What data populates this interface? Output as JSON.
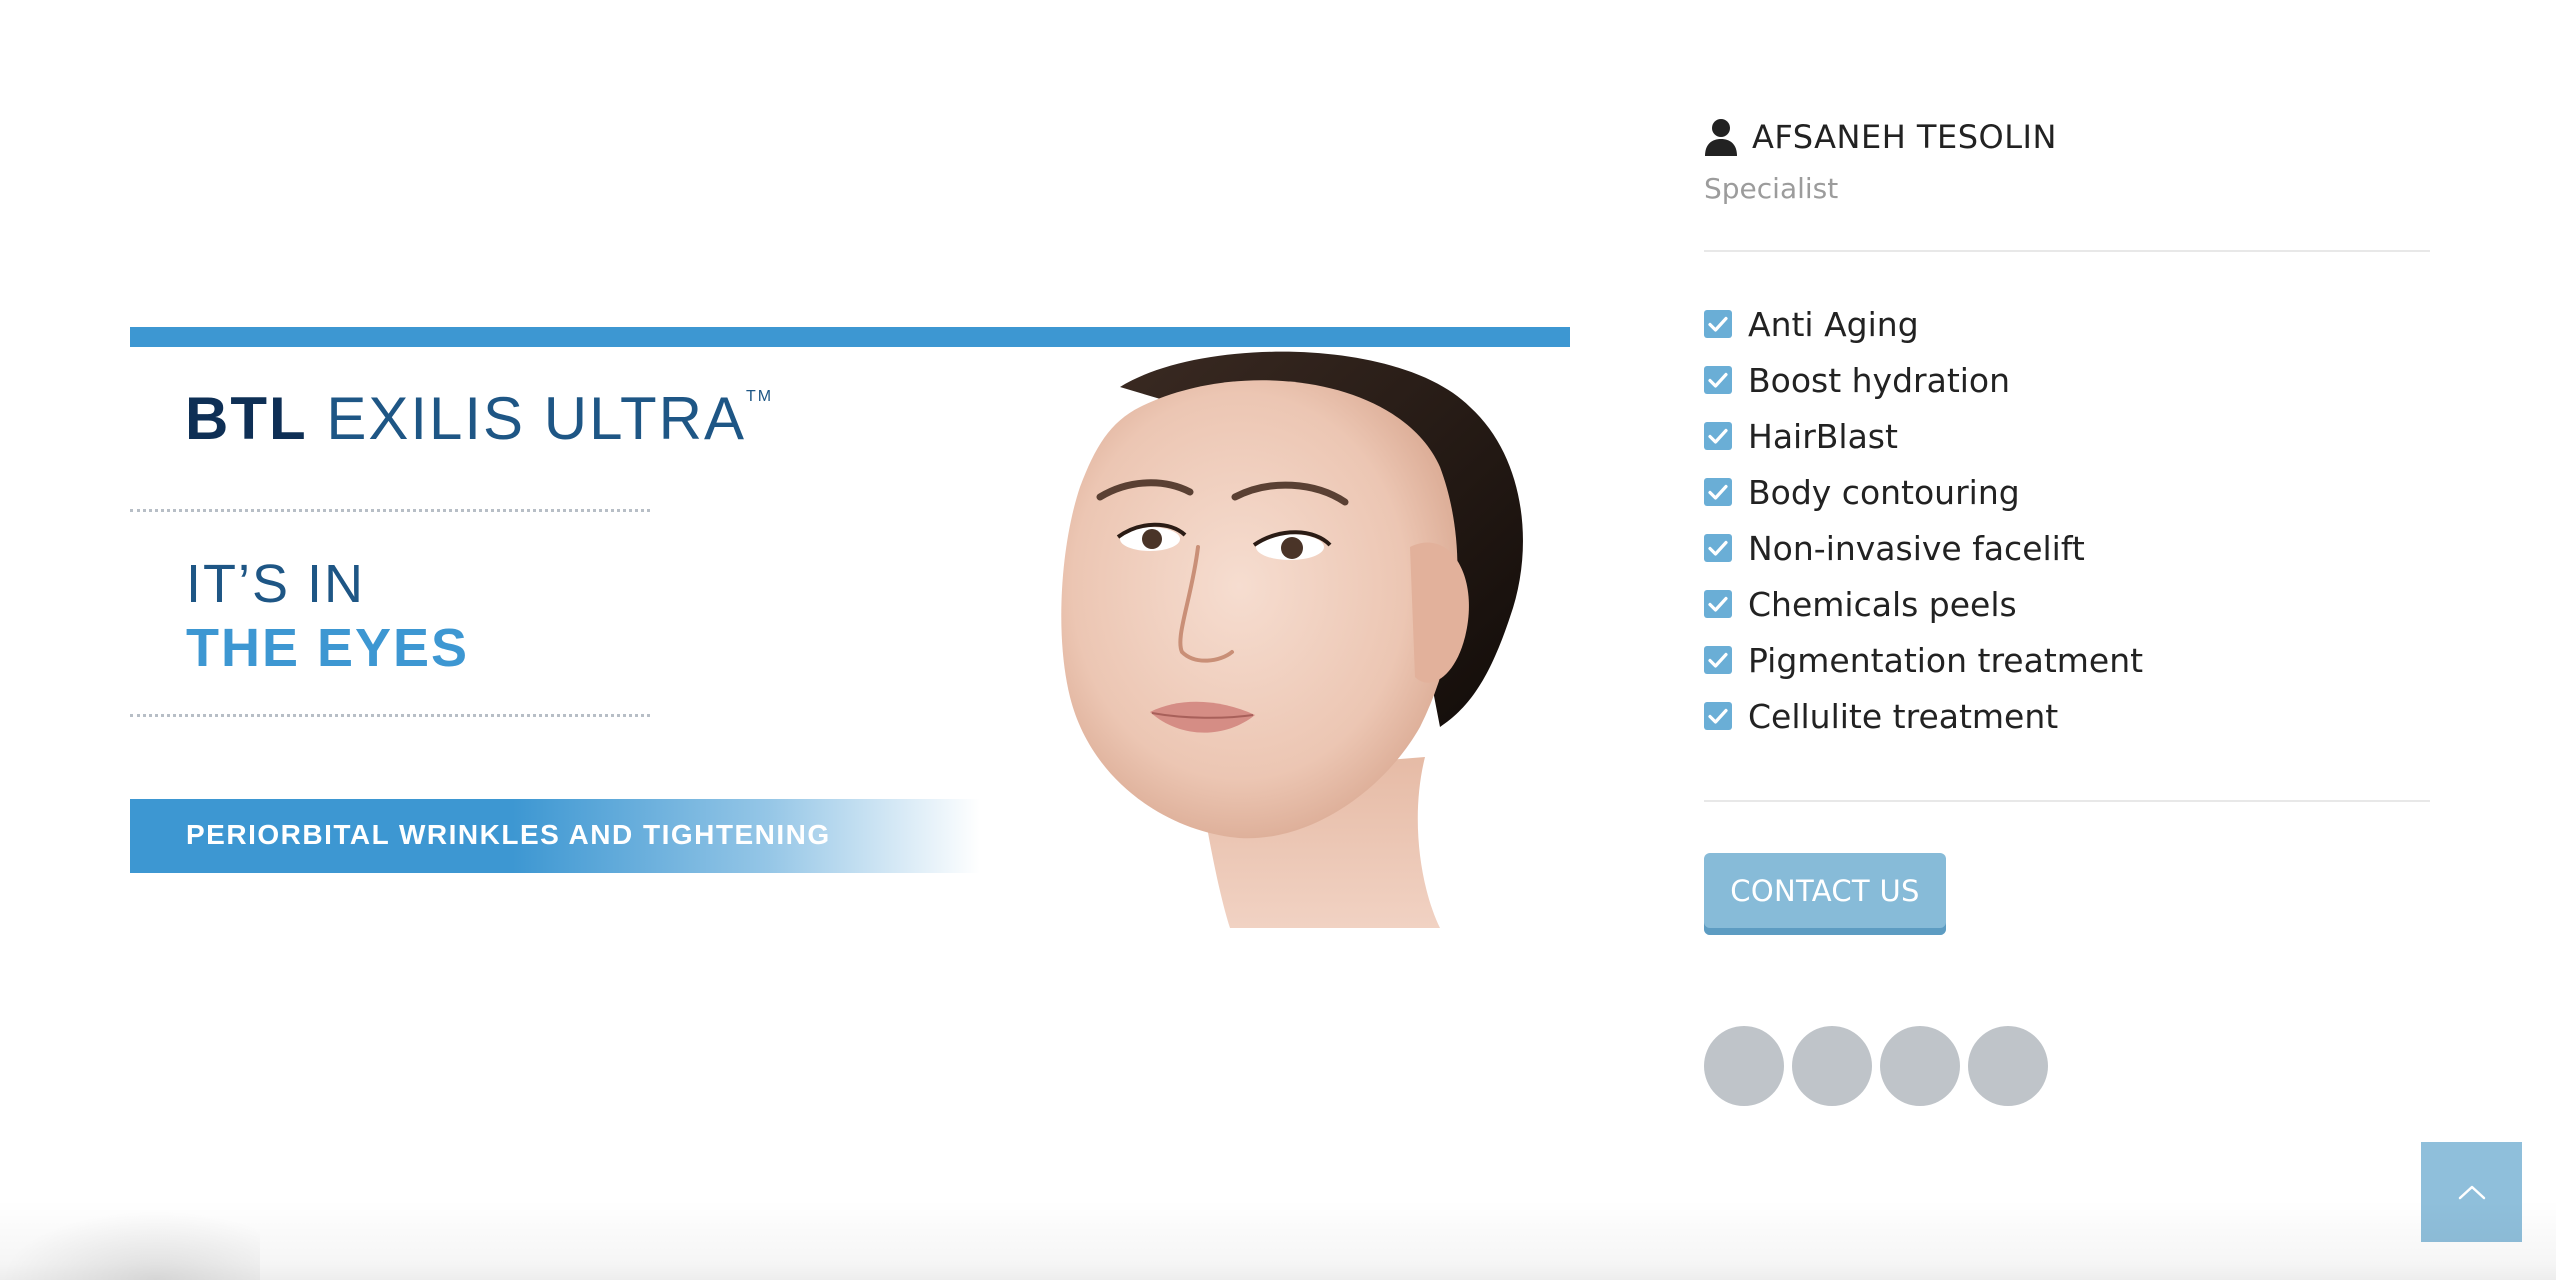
{
  "banner": {
    "brand_btl": "BTL",
    "brand_product": "EXILIS ULTRA",
    "brand_tm": "TM",
    "tagline_line1": "IT’S IN",
    "tagline_line2": "THE EYES",
    "ribbon_text": "PERIORBITAL WRINKLES AND TIGHTENING",
    "accent_color": "#3d97d2",
    "brand_color": "#0e2f55"
  },
  "profile": {
    "icon": "user-icon",
    "name": "AFSANEH TESOLIN",
    "role": "Specialist"
  },
  "services": {
    "check_icon": "checkbox-checked-icon",
    "items": [
      "Anti Aging",
      "Boost hydration",
      "HairBlast",
      "Body contouring",
      "Non-invasive facelift",
      "Chemicals peels",
      "Pigmentation treatment",
      "Cellulite treatment"
    ]
  },
  "contact": {
    "label": "CONTACT US",
    "color": "#87bbd8"
  },
  "social": {
    "count": 4,
    "color": "#bfc4c9"
  },
  "back_to_top": {
    "icon": "chevron-up-icon",
    "color": "#8fbfdb"
  }
}
